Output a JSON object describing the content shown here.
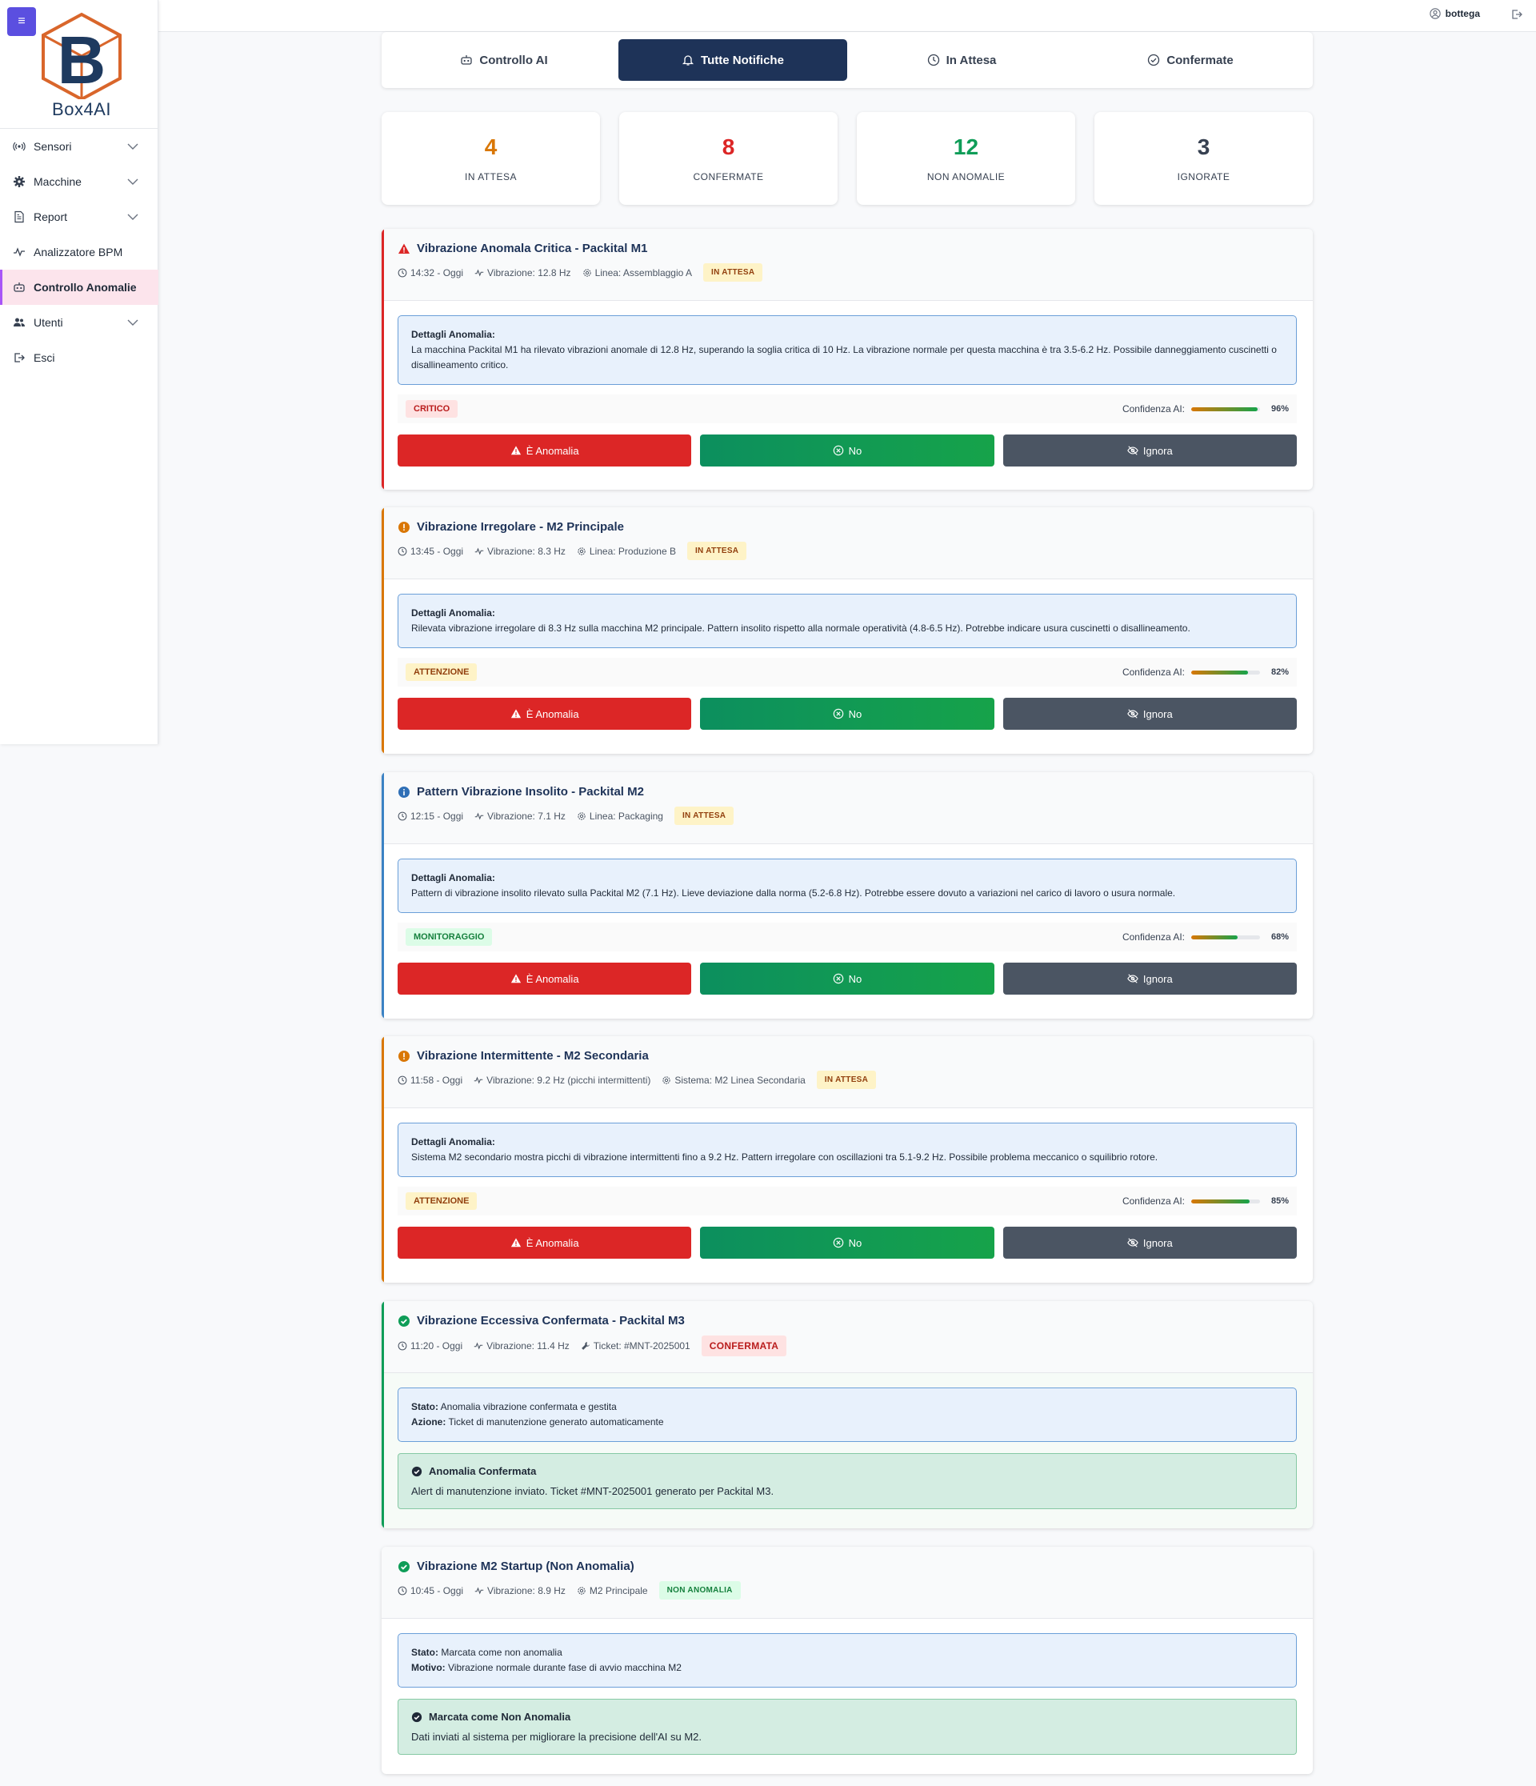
{
  "app": {
    "logo_text": "Box4AI",
    "user": "bottega"
  },
  "sidebar": {
    "items": [
      {
        "label": "Sensori",
        "icon": "sensor-icon",
        "has_submenu": true
      },
      {
        "label": "Macchine",
        "icon": "gear-icon",
        "has_submenu": true
      },
      {
        "label": "Report",
        "icon": "report-icon",
        "has_submenu": true
      },
      {
        "label": "Analizzatore BPM",
        "icon": "pulse-icon",
        "has_submenu": false
      },
      {
        "label": "Controllo Anomalie",
        "icon": "robot-icon",
        "has_submenu": false,
        "active": true
      },
      {
        "label": "Utenti",
        "icon": "users-icon",
        "has_submenu": true
      },
      {
        "label": "Esci",
        "icon": "logout-icon",
        "has_submenu": false
      }
    ]
  },
  "tabs": [
    {
      "label": "Controllo AI",
      "icon": "robot-icon"
    },
    {
      "label": "Tutte Notifiche",
      "icon": "bell-icon",
      "active": true
    },
    {
      "label": "In Attesa",
      "icon": "clock-icon"
    },
    {
      "label": "Confermate",
      "icon": "check-circle-icon"
    }
  ],
  "stats": [
    {
      "value": "4",
      "label": "IN ATTESA",
      "color": "#d97706"
    },
    {
      "value": "8",
      "label": "CONFERMATE",
      "color": "#dc2626"
    },
    {
      "value": "12",
      "label": "NON ANOMALIE",
      "color": "#0f9d58"
    },
    {
      "value": "3",
      "label": "IGNORATE",
      "color": "#374151"
    }
  ],
  "cards": [
    {
      "title": "Vibrazione Anomala Critica - Packital M1",
      "time": "14:32 - Oggi",
      "vibration": "Vibrazione: 12.8 Hz",
      "location": "Linea: Assemblaggio A",
      "status": "IN ATTESA",
      "details_label": "Dettagli Anomalia:",
      "details": "La macchina Packital M1 ha rilevato vibrazioni anomale di 12.8 Hz, superando la soglia critica di 10 Hz. La vibrazione normale per questa macchina è tra 3.5-6.2 Hz. Possibile danneggiamento cuscinetti o disallineamento critico.",
      "severity": "CRITICO",
      "confidence_label": "Confidenza AI:",
      "confidence": 96,
      "confidence_text": "96%",
      "btn_anomaly": "È Anomalia",
      "btn_no": "No",
      "btn_ignore": "Ignora"
    },
    {
      "title": "Vibrazione Irregolare - M2 Principale",
      "time": "13:45 - Oggi",
      "vibration": "Vibrazione: 8.3 Hz",
      "location": "Linea: Produzione B",
      "status": "IN ATTESA",
      "details_label": "Dettagli Anomalia:",
      "details": "Rilevata vibrazione irregolare di 8.3 Hz sulla macchina M2 principale. Pattern insolito rispetto alla normale operatività (4.8-6.5 Hz). Potrebbe indicare usura cuscinetti o disallineamento.",
      "severity": "ATTENZIONE",
      "confidence_label": "Confidenza AI:",
      "confidence": 82,
      "confidence_text": "82%",
      "btn_anomaly": "È Anomalia",
      "btn_no": "No",
      "btn_ignore": "Ignora"
    },
    {
      "title": "Pattern Vibrazione Insolito - Packital M2",
      "time": "12:15 - Oggi",
      "vibration": "Vibrazione: 7.1 Hz",
      "location": "Linea: Packaging",
      "status": "IN ATTESA",
      "details_label": "Dettagli Anomalia:",
      "details": "Pattern di vibrazione insolito rilevato sulla Packital M2 (7.1 Hz). Lieve deviazione dalla norma (5.2-6.8 Hz). Potrebbe essere dovuto a variazioni nel carico di lavoro o usura normale.",
      "severity": "MONITORAGGIO",
      "confidence_label": "Confidenza AI:",
      "confidence": 68,
      "confidence_text": "68%",
      "btn_anomaly": "È Anomalia",
      "btn_no": "No",
      "btn_ignore": "Ignora"
    },
    {
      "title": "Vibrazione Intermittente - M2 Secondaria",
      "time": "11:58 - Oggi",
      "vibration": "Vibrazione: 9.2 Hz (picchi intermittenti)",
      "location": "Sistema: M2 Linea Secondaria",
      "status": "IN ATTESA",
      "details_label": "Dettagli Anomalia:",
      "details": "Sistema M2 secondario mostra picchi di vibrazione intermittenti fino a 9.2 Hz. Pattern irregolare con oscillazioni tra 5.1-9.2 Hz. Possibile problema meccanico o squilibrio rotore.",
      "severity": "ATTENZIONE",
      "confidence_label": "Confidenza AI:",
      "confidence": 85,
      "confidence_text": "85%",
      "btn_anomaly": "È Anomalia",
      "btn_no": "No",
      "btn_ignore": "Ignora"
    },
    {
      "title": "Vibrazione Eccessiva Confermata - Packital M3",
      "time": "11:20 - Oggi",
      "vibration": "Vibrazione: 11.4 Hz",
      "location": "Ticket: #MNT-2025001",
      "status": "CONFERMATA",
      "state_label": "Stato:",
      "state": "Anomalia vibrazione confermata e gestita",
      "action_label": "Azione:",
      "action": "Ticket di manutenzione generato automaticamente",
      "ok_title": "Anomalia Confermata",
      "ok_msg": "Alert di manutenzione inviato. Ticket #MNT-2025001 generato per Packital M3."
    },
    {
      "title": "Vibrazione M2 Startup (Non Anomalia)",
      "time": "10:45 - Oggi",
      "vibration": "Vibrazione: 8.9 Hz",
      "location": "M2 Principale",
      "status": "NON ANOMALIA",
      "state_label": "Stato:",
      "state": "Marcata come non anomalia",
      "action_label": "Motivo:",
      "action": "Vibrazione normale durante fase di avvio macchina M2",
      "ok_title": "Marcata come Non Anomalia",
      "ok_msg": "Dati inviati al sistema per migliorare la precisione dell'AI su M2."
    }
  ]
}
